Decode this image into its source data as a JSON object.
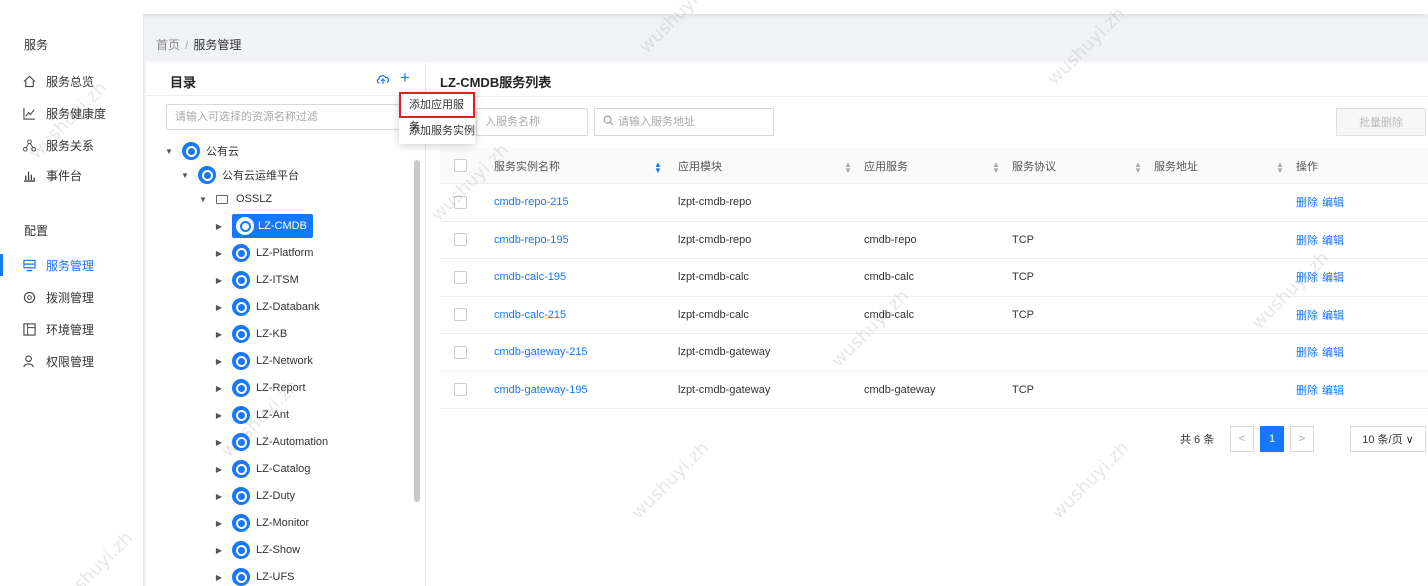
{
  "sidebar": {
    "section_service": "服务",
    "section_config": "配置",
    "items": [
      {
        "label": "服务总览",
        "icon": "home-icon"
      },
      {
        "label": "服务健康度",
        "icon": "line-chart-icon"
      },
      {
        "label": "服务关系",
        "icon": "relation-icon"
      },
      {
        "label": "事件台",
        "icon": "bar-chart-icon"
      },
      {
        "label": "服务管理",
        "icon": "service-icon",
        "active": true
      },
      {
        "label": "拨测管理",
        "icon": "probe-icon"
      },
      {
        "label": "环境管理",
        "icon": "env-icon"
      },
      {
        "label": "权限管理",
        "icon": "user-icon"
      }
    ]
  },
  "breadcrumb": {
    "home": "首页",
    "sep": "/",
    "current": "服务管理"
  },
  "tree": {
    "title": "目录",
    "add_symbol": "+",
    "filter_placeholder": "请输入可选择的资源名称过滤",
    "nodes": [
      {
        "label": "公有云",
        "caret": "▼",
        "kind": "cloud"
      },
      {
        "label": "公有云运维平台",
        "caret": "▼",
        "kind": "cloud"
      },
      {
        "label": "OSSLZ",
        "caret": "▼",
        "kind": "folder"
      },
      {
        "label": "LZ-CMDB",
        "caret": "▶",
        "kind": "node",
        "selected": true
      },
      {
        "label": "LZ-Platform",
        "caret": "▶",
        "kind": "node"
      },
      {
        "label": "LZ-ITSM",
        "caret": "▶",
        "kind": "node"
      },
      {
        "label": "LZ-Databank",
        "caret": "▶",
        "kind": "node"
      },
      {
        "label": "LZ-KB",
        "caret": "▶",
        "kind": "node"
      },
      {
        "label": "LZ-Network",
        "caret": "▶",
        "kind": "node"
      },
      {
        "label": "LZ-Report",
        "caret": "▶",
        "kind": "node"
      },
      {
        "label": "LZ-Ant",
        "caret": "▶",
        "kind": "node"
      },
      {
        "label": "LZ-Automation",
        "caret": "▶",
        "kind": "node"
      },
      {
        "label": "LZ-Catalog",
        "caret": "▶",
        "kind": "node"
      },
      {
        "label": "LZ-Duty",
        "caret": "▶",
        "kind": "node"
      },
      {
        "label": "LZ-Monitor",
        "caret": "▶",
        "kind": "node"
      },
      {
        "label": "LZ-Show",
        "caret": "▶",
        "kind": "node"
      },
      {
        "label": "LZ-UFS",
        "caret": "▶",
        "kind": "node"
      }
    ]
  },
  "context_menu": {
    "items": [
      "添加应用服务",
      "添加服务实例"
    ]
  },
  "list": {
    "title": "LZ-CMDB服务列表",
    "search_name_placeholder": "入服务名称",
    "search_addr_placeholder": "请输入服务地址",
    "batch_delete": "批量删除",
    "columns": [
      "服务实例名称",
      "应用模块",
      "应用服务",
      "服务协议",
      "服务地址",
      "操作"
    ],
    "rows": [
      {
        "name": "cmdb-repo-215",
        "module": "lzpt-cmdb-repo",
        "service": "",
        "protocol": "",
        "address": ""
      },
      {
        "name": "cmdb-repo-195",
        "module": "lzpt-cmdb-repo",
        "service": "cmdb-repo",
        "protocol": "TCP",
        "address": ""
      },
      {
        "name": "cmdb-calc-195",
        "module": "lzpt-cmdb-calc",
        "service": "cmdb-calc",
        "protocol": "TCP",
        "address": ""
      },
      {
        "name": "cmdb-calc-215",
        "module": "lzpt-cmdb-calc",
        "service": "cmdb-calc",
        "protocol": "TCP",
        "address": ""
      },
      {
        "name": "cmdb-gateway-215",
        "module": "lzpt-cmdb-gateway",
        "service": "",
        "protocol": "",
        "address": ""
      },
      {
        "name": "cmdb-gateway-195",
        "module": "lzpt-cmdb-gateway",
        "service": "cmdb-gateway",
        "protocol": "TCP",
        "address": ""
      }
    ],
    "actions": {
      "delete": "删除",
      "edit": "编辑"
    }
  },
  "pagination": {
    "total": "共 6 条",
    "prev": "<",
    "page": "1",
    "next": ">",
    "page_size": "10 条/页 ∨"
  },
  "watermark": "wushuyi.zh",
  "colors": {
    "accent": "#1677ff",
    "highlight": "#e02020"
  }
}
